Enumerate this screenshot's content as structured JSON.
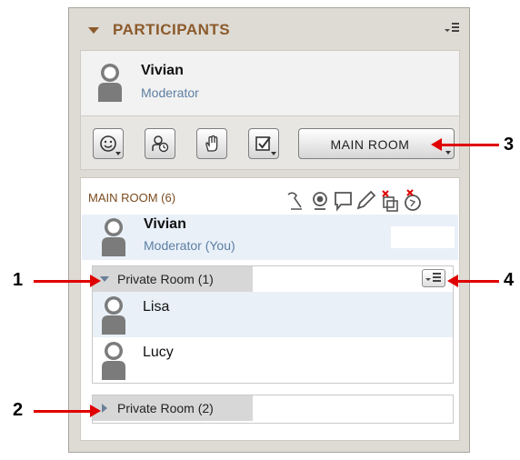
{
  "panel": {
    "title": "PARTICIPANTS",
    "menu_icon": "options-menu-icon"
  },
  "current_user": {
    "name": "Vivian",
    "role": "Moderator",
    "avatar_icon": "user-avatar-icon"
  },
  "toolbar": {
    "buttons": [
      {
        "name": "emoticon-button",
        "icon": "smiley-icon",
        "has_dropdown": true
      },
      {
        "name": "step-away-button",
        "icon": "away-clock-icon",
        "has_dropdown": false
      },
      {
        "name": "raise-hand-button",
        "icon": "hand-icon",
        "has_dropdown": false
      },
      {
        "name": "feedback-button",
        "icon": "checkbox-icon",
        "has_dropdown": true
      }
    ],
    "room_button_label": "MAIN ROOM"
  },
  "main_room": {
    "label": "MAIN ROOM (6)",
    "column_icons": [
      "telephone-icon",
      "webcam-icon",
      "chat-icon",
      "pencil-icon",
      "share-app-disabled-icon",
      "web-tour-disabled-icon"
    ],
    "me": {
      "name": "Vivian",
      "role": "Moderator (You)"
    }
  },
  "private_rooms": [
    {
      "label": "Private Room (1)",
      "expanded": true,
      "members": [
        "Lisa",
        "Lucy"
      ]
    },
    {
      "label": "Private Room (2)",
      "expanded": false,
      "members": []
    }
  ],
  "annotations": [
    "1",
    "2",
    "3",
    "4"
  ],
  "colors": {
    "accent_brown": "#8b5a2b",
    "role_blue": "#5d7fa3",
    "arrow_red": "#e00000",
    "panel_bg": "#dedad4"
  }
}
